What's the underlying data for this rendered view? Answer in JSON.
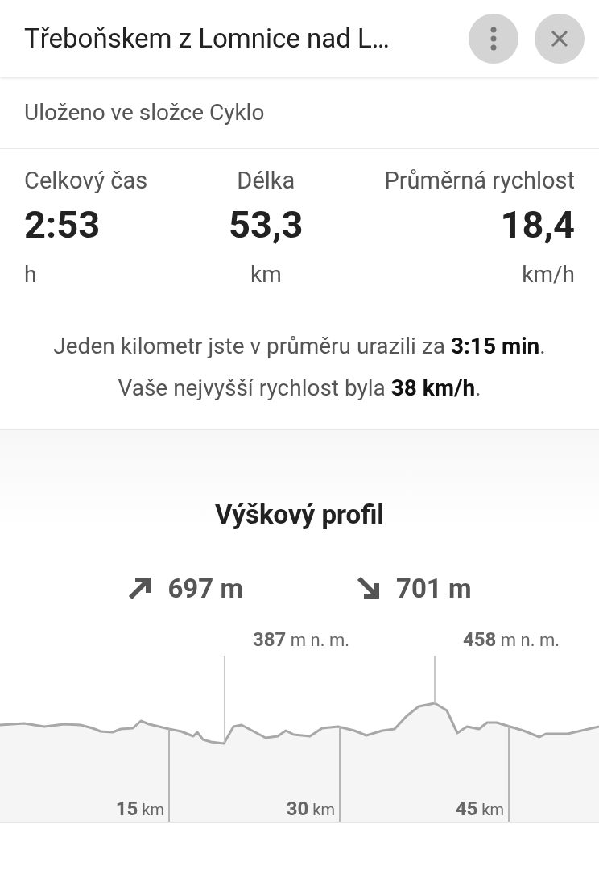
{
  "header": {
    "title": "Třeboňskem z Lomnice nad L…"
  },
  "folder": "Uloženo ve složce Cyklo",
  "stats": [
    {
      "label": "Celkový čas",
      "value": "2:53",
      "unit": "h"
    },
    {
      "label": "Délka",
      "value": "53,3",
      "unit": "km"
    },
    {
      "label": "Průměrná rychlost",
      "value": "18,4",
      "unit": "km/h"
    }
  ],
  "summary": [
    "Jeden kilometr jste v průměru urazili za **3:15 min**.",
    "Vaše nejvyšší rychlost byla **38 km/h**."
  ],
  "elevation": {
    "title": "Výškový profil",
    "ascent": "697 m",
    "descent": "701 m",
    "peaks": [
      {
        "value": "387",
        "unit": "m n. m."
      },
      {
        "value": "458",
        "unit": "m n. m."
      }
    ],
    "distance_marks": [
      {
        "value": "15",
        "unit": "km"
      },
      {
        "value": "30",
        "unit": "km"
      },
      {
        "value": "45",
        "unit": "km"
      }
    ]
  }
}
